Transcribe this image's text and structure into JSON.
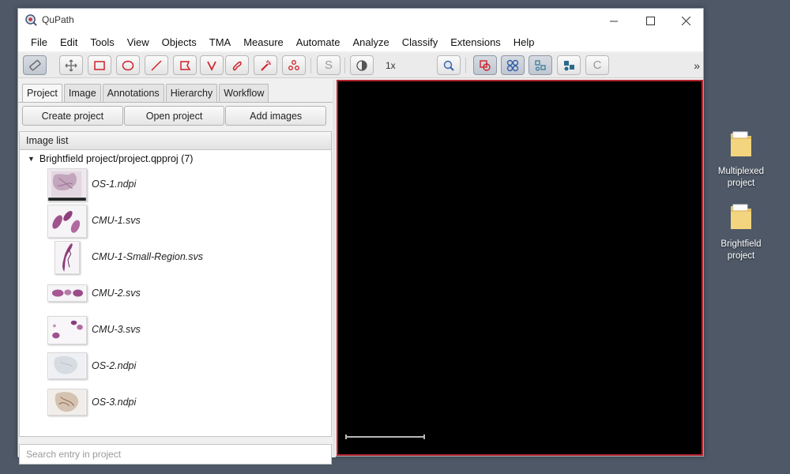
{
  "window": {
    "title": "QuPath",
    "controls": [
      "minimize",
      "maximize",
      "close"
    ]
  },
  "menu": [
    "File",
    "Edit",
    "Tools",
    "View",
    "Objects",
    "TMA",
    "Measure",
    "Automate",
    "Analyze",
    "Classify",
    "Extensions",
    "Help"
  ],
  "toolbar": {
    "zoom_label": "1x",
    "tools": [
      "ruler-icon",
      "move-icon",
      "rectangle-icon",
      "ellipse-icon",
      "line-icon",
      "polygon-icon",
      "polyline-icon",
      "brush-icon",
      "wand-icon",
      "points-icon",
      "selection-mode-icon",
      "brightness-contrast-icon",
      "zoom-to-fit-icon",
      "show-annotations-icon",
      "show-tma-grid-icon",
      "show-detections-icon",
      "fill-detections-icon",
      "pixel-classification-icon",
      "overflow-icon"
    ],
    "overflow": "»",
    "s_label": "S",
    "c_label": "C"
  },
  "left_panel": {
    "tabs": [
      "Project",
      "Image",
      "Annotations",
      "Hierarchy",
      "Workflow"
    ],
    "active_tab": "Project",
    "buttons": {
      "create": "Create project",
      "open": "Open project",
      "add": "Add images"
    },
    "list_title": "Image list",
    "project_root": "Brightfield project/project.qpproj (7)",
    "images": [
      {
        "name": "OS-1.ndpi"
      },
      {
        "name": "CMU-1.svs"
      },
      {
        "name": "CMU-1-Small-Region.svs"
      },
      {
        "name": "CMU-2.svs"
      },
      {
        "name": "CMU-3.svs"
      },
      {
        "name": "OS-2.ndpi"
      },
      {
        "name": "OS-3.ndpi"
      }
    ],
    "search_placeholder": "Search entry in project"
  },
  "viewer": {
    "background": "#000000",
    "border_color": "#b3262e"
  },
  "desktop": {
    "icons": [
      {
        "label": "Multiplexed project"
      },
      {
        "label": "Brightfield project"
      }
    ]
  },
  "colors": {
    "accent_red": "#d0202a",
    "accent_blue": "#3560a8",
    "desktop": "#4e5866"
  }
}
